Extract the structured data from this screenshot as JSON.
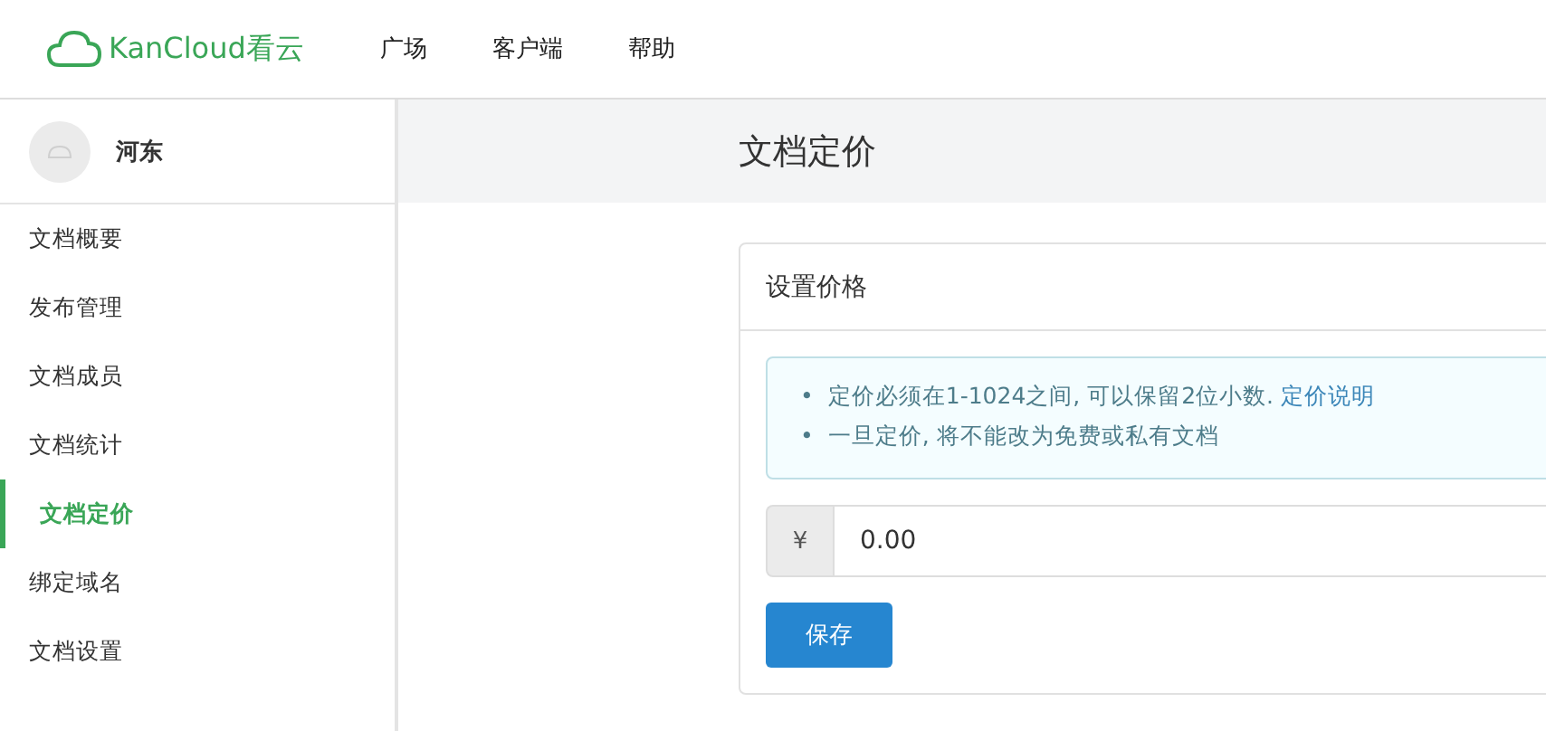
{
  "logo": {
    "text": "KanCloud看云"
  },
  "nav": [
    {
      "label": "广场"
    },
    {
      "label": "客户端"
    },
    {
      "label": "帮助"
    }
  ],
  "user": {
    "name": "河东"
  },
  "sidebar": {
    "items": [
      {
        "label": "文档概要",
        "selected": false
      },
      {
        "label": "发布管理",
        "selected": false
      },
      {
        "label": "文档成员",
        "selected": false
      },
      {
        "label": "文档统计",
        "selected": false
      },
      {
        "label": "文档定价",
        "selected": true
      },
      {
        "label": "绑定域名",
        "selected": false
      },
      {
        "label": "文档设置",
        "selected": false
      }
    ]
  },
  "page_title": "文档定价",
  "card": {
    "title": "设置价格",
    "notes": [
      {
        "bullet": "•",
        "text": "定价必须在1-1024之间, 可以保留2位小数.",
        "link": "定价说明"
      },
      {
        "bullet": "•",
        "text": "一旦定价, 将不能改为免费或私有文档"
      }
    ],
    "currency": "¥",
    "price": "0.00",
    "save": "保存"
  }
}
